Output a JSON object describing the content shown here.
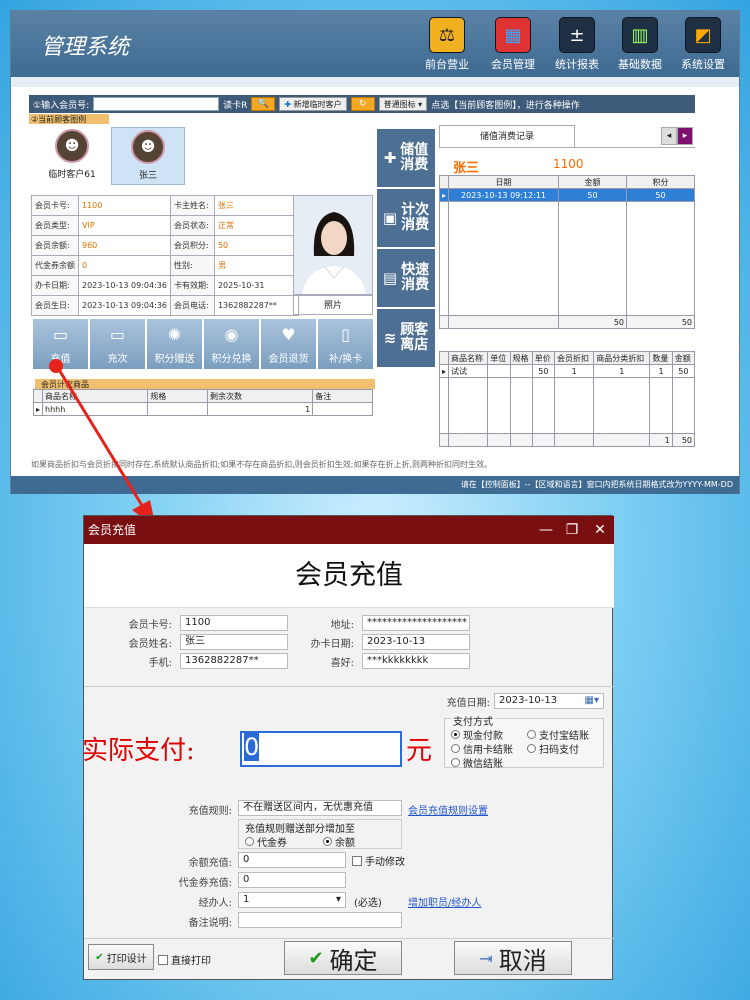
{
  "app": {
    "title": "管理系统",
    "nav": [
      {
        "label": "前台营业",
        "icon": "front-desk-icon",
        "glyph": "⚖"
      },
      {
        "label": "会员管理",
        "icon": "members-icon",
        "glyph": "▦"
      },
      {
        "label": "统计报表",
        "icon": "stats-icon",
        "glyph": "±"
      },
      {
        "label": "基础数据",
        "icon": "data-icon",
        "glyph": "▥"
      },
      {
        "label": "系统设置",
        "icon": "settings-icon",
        "glyph": "◩"
      }
    ],
    "search": {
      "label": "①输入会员号:",
      "read_card": "读卡R",
      "add_temp": "新增临时客户",
      "icon_select": "普通图标",
      "hint": "点选【当前顾客图例】，进行各种操作"
    },
    "current_label": "②当前顾客图例",
    "customers": [
      {
        "name": "临时客户61"
      },
      {
        "name": "张三"
      }
    ],
    "info_rows": [
      {
        "l1": "会员卡号:",
        "v1": "1100",
        "l2": "卡主姓名:",
        "v2": "张三"
      },
      {
        "l1": "会员类型:",
        "v1": "VIP",
        "l2": "会员状态:",
        "v2": "正常"
      },
      {
        "l1": "会员余额:",
        "v1": "960",
        "l2": "会员积分:",
        "v2": "50"
      },
      {
        "l1": "代金券余额",
        "v1": "0",
        "l2": "性别:",
        "v2": "男"
      },
      {
        "l1": "办卡日期:",
        "v1": "2023-10-13 09:04:36",
        "l2": "卡有效期:",
        "v2": "2025-10-31"
      },
      {
        "l1": "会员生日:",
        "v1": "2023-10-13 09:04:36",
        "l2": "会员电话:",
        "v2": "13628822​87**"
      }
    ],
    "photo_label": "照片",
    "services": [
      {
        "label": "储值消费",
        "glyph": "✚"
      },
      {
        "label": "计次消费",
        "glyph": "▣"
      },
      {
        "label": "快速消费",
        "glyph": "▤"
      },
      {
        "label": "顾客离店",
        "glyph": "≋"
      }
    ],
    "ops": [
      {
        "label": "充值",
        "glyph": "▭"
      },
      {
        "label": "充次",
        "glyph": "▭"
      },
      {
        "label": "积分赠送",
        "glyph": "✺"
      },
      {
        "label": "积分兑换",
        "glyph": "◉"
      },
      {
        "label": "会员退货",
        "glyph": "♥"
      },
      {
        "label": "补/换卡",
        "glyph": "▯"
      }
    ],
    "gift_label": "会员计次商品",
    "gift_headers": [
      "商品名称",
      "规格",
      "剩余次数",
      "备注"
    ],
    "gift_rows": [
      [
        "hhhh",
        "",
        "1",
        ""
      ]
    ],
    "right_tab": "储值消费记录",
    "right_name": "张三",
    "right_card": "1100",
    "record_headers": [
      "日期",
      "金额",
      "积分"
    ],
    "record_rows": [
      [
        "2023-10-13 09:12:11",
        "50",
        "50"
      ]
    ],
    "record_totals": [
      "50",
      "50"
    ],
    "goods_headers": [
      "商品名称",
      "单位",
      "规格",
      "单价",
      "会员折扣",
      "商品分类折扣",
      "数量",
      "金额"
    ],
    "goods_rows": [
      [
        "试试",
        "",
        "",
        "50",
        "1",
        "1",
        "1",
        "50"
      ]
    ],
    "goods_totals": [
      "1",
      "50"
    ],
    "note": "如果商品折扣与会员折扣同时存在,系统默认商品折扣;如果不存在商品折扣,则会员折扣生效;如果存在折上折,则两种折扣同时生效。",
    "status": "请在【控制面板】--【区域和语言】窗口内把系统日期格式改为YYYY-MM-DD"
  },
  "dialog": {
    "title": "会员充值",
    "heading": "会员充值",
    "card_no_label": "会员卡号:",
    "card_no": "1100",
    "name_label": "会员姓名:",
    "name": "张三",
    "phone_label": "手机:",
    "phone": "13628822​87**",
    "address_label": "地址:",
    "address": "********************",
    "open_date_label": "办卡日期:",
    "open_date": "2023-10-13",
    "hobby_label": "喜好:",
    "hobby": "***kkkkkkkk",
    "recharge_date_label": "充值日期:",
    "recharge_date": "2023-10-13",
    "pay_method_label": "支付方式",
    "pay_methods": [
      "现金付款",
      "支付宝结账",
      "信用卡结账",
      "扫码支付",
      "微信结账"
    ],
    "pay_label": "实际支付:",
    "pay_value": "0",
    "yuan": "元",
    "rule_label": "充值规则:",
    "rule_value": "不在赠送区间内，无优惠充值",
    "rule_link": "会员充值规则设置",
    "bonus_label": "充值规则赠送部分增加至",
    "bonus_options": [
      "代金券",
      "余额"
    ],
    "balance_label": "余额充值:",
    "balance_value": "0",
    "manual_label": "手动修改",
    "voucher_label": "代金券充值:",
    "voucher_value": "0",
    "handler_label": "经办人:",
    "handler_value": "1",
    "required": "(必选)",
    "handler_link": "增加职员/经办人",
    "remark_label": "备注说明:",
    "remark_value": "",
    "print_design": "打印设计",
    "direct_print": "直接打印",
    "ok": "确定",
    "cancel": "取消"
  }
}
